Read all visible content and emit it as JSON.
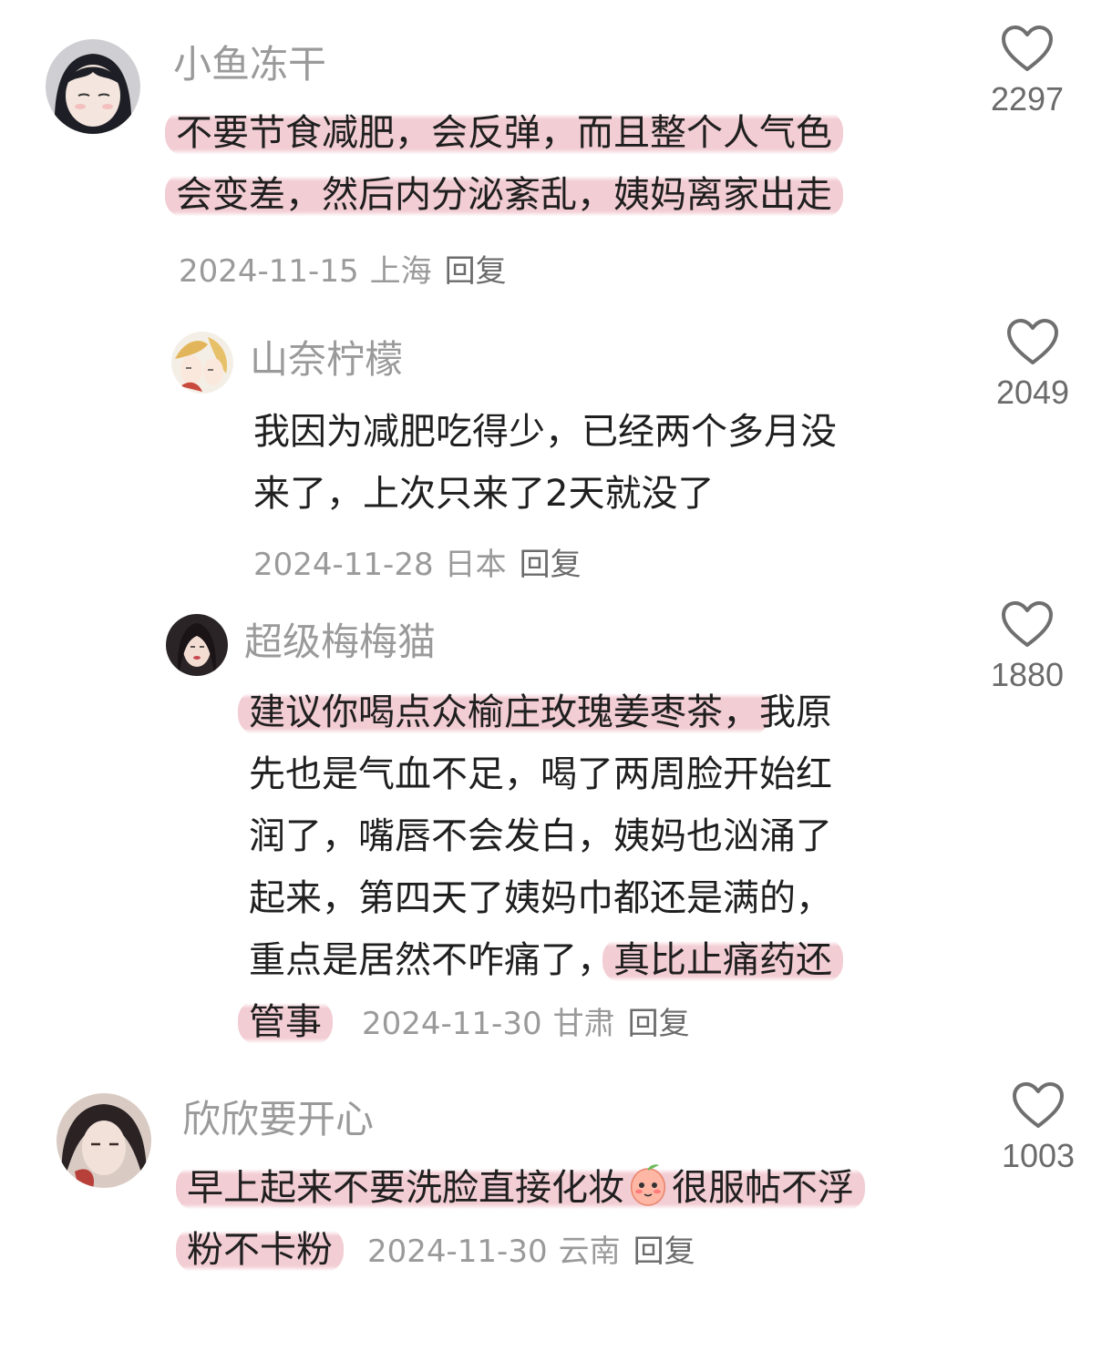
{
  "comments": [
    {
      "username": "小鱼冻干",
      "lines": [
        "不要节食减肥，会反弹，而且整个人气色",
        "会变差，然后内分泌紊乱，姨妈离家出走"
      ],
      "date": "2024-11-15",
      "location": "上海",
      "reply": "回复",
      "likes": "2297"
    },
    {
      "username": "山奈柠檬",
      "lines": [
        "我因为减肥吃得少，已经两个多月没",
        "来了，上次只来了2天就没了"
      ],
      "date": "2024-11-28",
      "location": "日本",
      "reply": "回复",
      "likes": "2049"
    },
    {
      "username": "超级梅梅猫",
      "lines": [
        "建议你喝点众榆庄玫瑰姜枣茶，",
        "我原",
        "先也是气血不足，喝了两周脸开始红",
        "润了，嘴唇不会发白，姨妈也汹涌了",
        "起来，第四天了姨妈巾都还是满的，",
        "重点是居然不咋痛了，",
        "真比止痛药还",
        "管事"
      ],
      "date": "2024-11-30",
      "location": "甘肃",
      "reply": "回复",
      "likes": "1880"
    },
    {
      "username": "欣欣要开心",
      "lines": [
        "早上起来不要洗脸直接化妆",
        "很服帖不浮",
        "粉不卡粉"
      ],
      "emoji": "shy-peach-emoji",
      "date": "2024-11-30",
      "location": "云南",
      "reply": "回复",
      "likes": "1003"
    }
  ],
  "icons": {
    "like": "heart-outline-icon"
  },
  "colors": {
    "highlight": "#f0c4cc",
    "meta": "#9a9a9a",
    "text": "#1f1f1f"
  }
}
